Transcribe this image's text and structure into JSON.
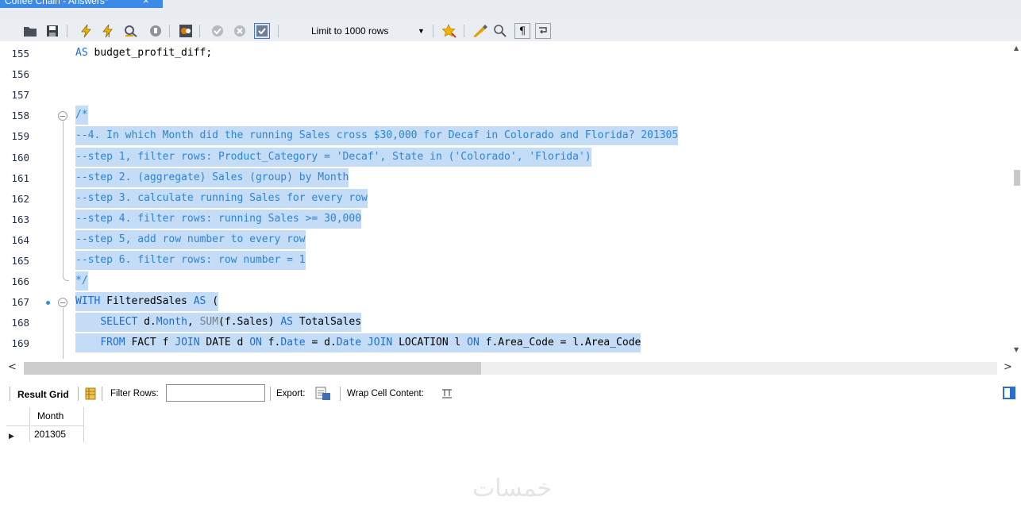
{
  "tab": {
    "title": "Coffee Chain - Answers*",
    "close": "×"
  },
  "toolbar": {
    "limit_label": "Limit to 1000 rows",
    "icons": [
      "open-folder-icon",
      "save-icon",
      "execute-icon",
      "execute-current-icon",
      "explain-icon",
      "stop-icon",
      "toggle-error-icon",
      "commit-icon",
      "rollback-icon",
      "autocommit-icon",
      "bookmark-star-icon",
      "beautify-icon",
      "find-icon",
      "invisible-chars-icon",
      "wrap-icon"
    ]
  },
  "editor": {
    "lines": [
      {
        "num": "155",
        "tokens": [
          [
            "kw",
            "AS "
          ],
          [
            "",
            "budget_profit_diff;"
          ]
        ],
        "selected": false
      },
      {
        "num": "156",
        "tokens": [],
        "selected": false
      },
      {
        "num": "157",
        "tokens": [],
        "selected": false
      },
      {
        "num": "158",
        "tokens": [
          [
            "cm",
            "/*"
          ]
        ],
        "selected": true,
        "fold": "start"
      },
      {
        "num": "159",
        "tokens": [
          [
            "cm",
            "--4. In which Month did the running Sales cross $30,000 for Decaf in Colorado and Florida? 201305"
          ]
        ],
        "selected": true
      },
      {
        "num": "160",
        "tokens": [
          [
            "cm",
            "--step 1, filter rows: Product_Category = 'Decaf', State in ('Colorado', 'Florida')"
          ]
        ],
        "selected": true
      },
      {
        "num": "161",
        "tokens": [
          [
            "cm",
            "--step 2. (aggregate) Sales (group) by Month"
          ]
        ],
        "selected": true
      },
      {
        "num": "162",
        "tokens": [
          [
            "cm",
            "--step 3. calculate running Sales for every row"
          ]
        ],
        "selected": true
      },
      {
        "num": "163",
        "tokens": [
          [
            "cm",
            "--step 4. filter rows: running Sales >= 30,000"
          ]
        ],
        "selected": true
      },
      {
        "num": "164",
        "tokens": [
          [
            "cm",
            "--step 5, add row number to every row"
          ]
        ],
        "selected": true
      },
      {
        "num": "165",
        "tokens": [
          [
            "cm",
            "--step 6. filter rows: row number = 1"
          ]
        ],
        "selected": true
      },
      {
        "num": "166",
        "tokens": [
          [
            "cm",
            "*/"
          ]
        ],
        "selected": true,
        "fold": "end"
      },
      {
        "num": "167",
        "tokens": [
          [
            "kw",
            "WITH "
          ],
          [
            "",
            "FilteredSales "
          ],
          [
            "kw",
            "AS"
          ],
          [
            "",
            " ("
          ]
        ],
        "selected": true,
        "fold": "start",
        "dot": true
      },
      {
        "num": "168",
        "tokens": [
          [
            "",
            "    "
          ],
          [
            "kw",
            "SELECT "
          ],
          [
            "",
            "d."
          ],
          [
            "kw",
            "Month"
          ],
          [
            "",
            ", "
          ],
          [
            "fn",
            "SUM"
          ],
          [
            "",
            "(f.Sales) "
          ],
          [
            "kw",
            "AS "
          ],
          [
            "",
            "TotalSales"
          ]
        ],
        "selected": true
      },
      {
        "num": "169",
        "tokens": [
          [
            "",
            "    "
          ],
          [
            "kw",
            "FROM "
          ],
          [
            "",
            "FACT f "
          ],
          [
            "kw",
            "JOIN "
          ],
          [
            "",
            "DATE d "
          ],
          [
            "kw",
            "ON "
          ],
          [
            "",
            "f."
          ],
          [
            "kw",
            "Date"
          ],
          [
            "",
            " = d."
          ],
          [
            "kw",
            "Date "
          ],
          [
            "kw",
            "JOIN "
          ],
          [
            "",
            "LOCATION l "
          ],
          [
            "kw",
            "ON "
          ],
          [
            "",
            "f.Area_Code = l.Area_Code"
          ]
        ],
        "selected": true
      }
    ]
  },
  "result": {
    "grid_label": "Result Grid",
    "filter_label": "Filter Rows:",
    "filter_value": "",
    "export_label": "Export:",
    "wrap_label": "Wrap Cell Content:",
    "columns": [
      "Month"
    ],
    "rows": [
      [
        "201305"
      ]
    ]
  },
  "watermark": "خمسات",
  "colors": {
    "tab": "#3b8ae8",
    "selection": "#c4dcf5",
    "comment": "#2b84d8",
    "keyword": "#1e6bd6"
  }
}
